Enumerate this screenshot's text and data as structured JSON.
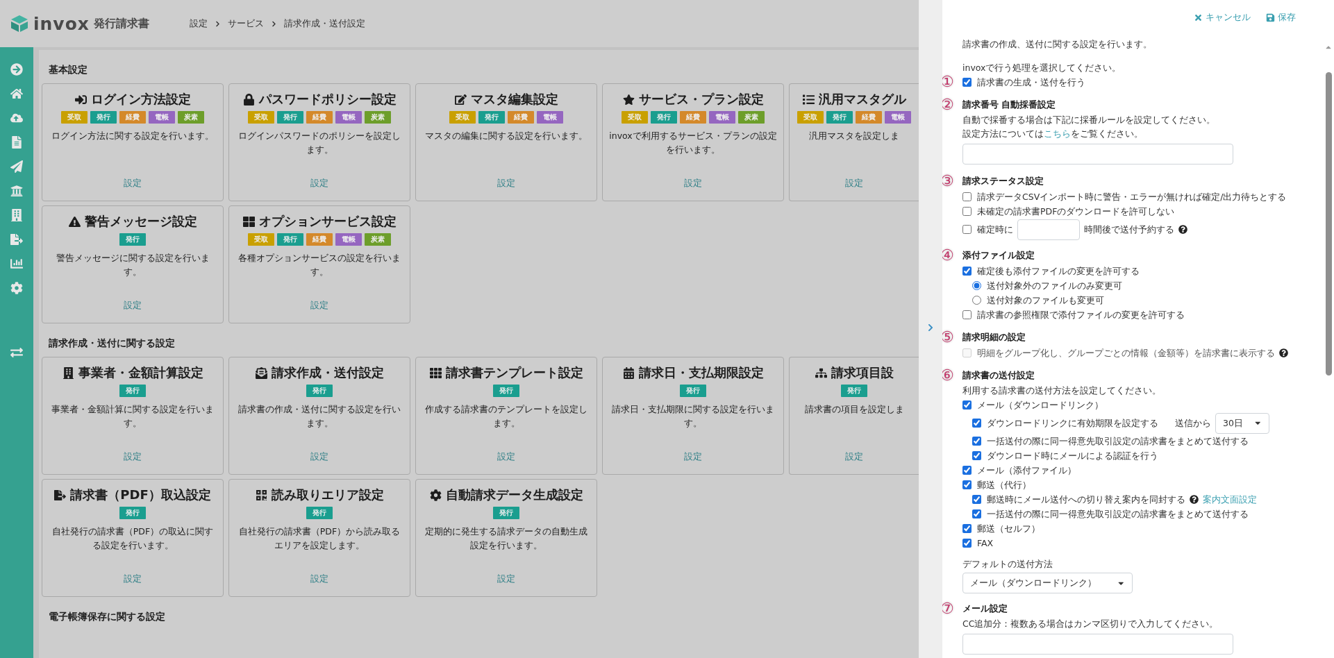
{
  "header": {
    "logo_text": "invox",
    "product": "発行請求書",
    "breadcrumb": [
      "設定",
      "サービス",
      "請求作成・送付設定"
    ]
  },
  "groups": [
    {
      "title": "基本設定",
      "cards": [
        {
          "title": "ログイン方法設定",
          "tags": [
            {
              "label": "受取",
              "color": "#c9a000"
            },
            {
              "label": "発行",
              "color": "#1a9e8f"
            },
            {
              "label": "経費",
              "color": "#d4892a"
            },
            {
              "label": "電帳",
              "color": "#9566c0"
            },
            {
              "label": "炭素",
              "color": "#6d9e2a"
            }
          ],
          "desc": "ログイン方法に関する設定を行います。",
          "link": "設定"
        },
        {
          "title": "パスワードポリシー設定",
          "tags": [
            {
              "label": "受取",
              "color": "#c9a000"
            },
            {
              "label": "発行",
              "color": "#1a9e8f"
            },
            {
              "label": "経費",
              "color": "#d4892a"
            },
            {
              "label": "電帳",
              "color": "#9566c0"
            },
            {
              "label": "炭素",
              "color": "#6d9e2a"
            }
          ],
          "desc": "ログインパスワードのポリシーを設定します。",
          "link": "設定"
        },
        {
          "title": "マスタ編集設定",
          "tags": [
            {
              "label": "受取",
              "color": "#c9a000"
            },
            {
              "label": "発行",
              "color": "#1a9e8f"
            },
            {
              "label": "経費",
              "color": "#d4892a"
            },
            {
              "label": "電帳",
              "color": "#9566c0"
            }
          ],
          "desc": "マスタの編集に関する設定を行います。",
          "link": "設定"
        },
        {
          "title": "サービス・プラン設定",
          "tags": [
            {
              "label": "受取",
              "color": "#c9a000"
            },
            {
              "label": "発行",
              "color": "#1a9e8f"
            },
            {
              "label": "経費",
              "color": "#d4892a"
            },
            {
              "label": "電帳",
              "color": "#9566c0"
            },
            {
              "label": "炭素",
              "color": "#6d9e2a"
            }
          ],
          "desc": "invoxで利用するサービス・プランの設定を行います。",
          "link": "設定"
        },
        {
          "title": "汎用マスタグル",
          "tags": [
            {
              "label": "受取",
              "color": "#c9a000"
            },
            {
              "label": "発行",
              "color": "#1a9e8f"
            },
            {
              "label": "経費",
              "color": "#d4892a"
            },
            {
              "label": "電帳",
              "color": "#9566c0"
            }
          ],
          "desc": "汎用マスタを設定しま",
          "link": "設定"
        },
        {
          "title": "警告メッセージ設定",
          "tags": [
            {
              "label": "発行",
              "color": "#1a9e8f"
            }
          ],
          "desc": "警告メッセージに関する設定を行います。",
          "link": "設定"
        },
        {
          "title": "オプションサービス設定",
          "tags": [
            {
              "label": "受取",
              "color": "#c9a000"
            },
            {
              "label": "発行",
              "color": "#1a9e8f"
            },
            {
              "label": "経費",
              "color": "#d4892a"
            },
            {
              "label": "電帳",
              "color": "#9566c0"
            },
            {
              "label": "炭素",
              "color": "#6d9e2a"
            }
          ],
          "desc": "各種オプションサービスの設定を行います。",
          "link": "設定"
        }
      ]
    },
    {
      "title": "請求作成・送付に関する設定",
      "cards": [
        {
          "title": "事業者・金額計算設定",
          "tags": [
            {
              "label": "発行",
              "color": "#1a9e8f"
            }
          ],
          "desc": "事業者・金額計算に関する設定を行います。",
          "link": "設定"
        },
        {
          "title": "請求作成・送付設定",
          "tags": [
            {
              "label": "発行",
              "color": "#1a9e8f"
            }
          ],
          "desc": "請求書の作成・送付に関する設定を行います。",
          "link": "設定"
        },
        {
          "title": "請求書テンプレート設定",
          "tags": [
            {
              "label": "発行",
              "color": "#1a9e8f"
            }
          ],
          "desc": "作成する請求書のテンプレートを設定します。",
          "link": "設定"
        },
        {
          "title": "請求日・支払期限設定",
          "tags": [
            {
              "label": "発行",
              "color": "#1a9e8f"
            }
          ],
          "desc": "請求日・支払期限に関する設定を行います。",
          "link": "設定"
        },
        {
          "title": "請求項目設",
          "tags": [
            {
              "label": "発行",
              "color": "#1a9e8f"
            }
          ],
          "desc": "請求書の項目を設定しま",
          "link": "設定"
        },
        {
          "title": "請求書（PDF）取込設定",
          "tags": [
            {
              "label": "発行",
              "color": "#1a9e8f"
            }
          ],
          "desc": "自社発行の請求書（PDF）の取込に関する設定を行います。",
          "link": "設定"
        },
        {
          "title": "読み取りエリア設定",
          "tags": [
            {
              "label": "発行",
              "color": "#1a9e8f"
            }
          ],
          "desc": "自社発行の請求書（PDF）から読み取るエリアを設定します。",
          "link": "設定"
        },
        {
          "title": "自動請求データ生成設定",
          "tags": [
            {
              "label": "発行",
              "color": "#1a9e8f"
            }
          ],
          "desc": "定期的に発生する請求データの自動生成設定を行います。",
          "link": "設定"
        }
      ]
    },
    {
      "title": "電子帳簿保存に関する設定"
    }
  ],
  "panel": {
    "actions": [
      {
        "kind": "cancel",
        "label": "キャンセル"
      },
      {
        "kind": "save",
        "label": "保存"
      }
    ],
    "intro": "請求書の作成、送付に関する設定を行います。",
    "sections": [
      {
        "lead": "invoxで行う処理を選択してください。",
        "marker": "①",
        "items": [
          {
            "kind": "checkbox",
            "label": "請求書の生成・送付を行う",
            "checked": true,
            "disabled": false
          }
        ]
      },
      {
        "marker": "②",
        "title": "請求番号 自動採番設定",
        "items": [
          {
            "kind": "text",
            "text": "自動で採番する場合は下記に採番ルールを設定してください。"
          },
          {
            "kind": "link_text",
            "before": "設定方法については",
            "link": "こちら",
            "after": "をご覧ください。"
          },
          {
            "kind": "input"
          }
        ]
      },
      {
        "marker": "③",
        "title": "請求ステータス設定",
        "items": [
          {
            "kind": "checkbox",
            "label": "請求データCSVインポート時に警告・エラーが無ければ確定/出力待ちとする",
            "checked": false,
            "disabled": false
          },
          {
            "kind": "checkbox",
            "label": "未確定の請求書PDFのダウンロードを許可しない",
            "checked": false,
            "disabled": false
          },
          {
            "kind": "hours",
            "before": "確定時に",
            "after": "時間後で送付予約する",
            "checked": false,
            "disabled": false,
            "help": true
          }
        ]
      },
      {
        "marker": "④",
        "title": "添付ファイル設定",
        "items": [
          {
            "kind": "checkbox",
            "label": "確定後も添付ファイルの変更を許可する",
            "checked": true,
            "disabled": false,
            "children": [
              {
                "kind": "radio",
                "label": "送付対象外のファイルのみ変更可",
                "selected": true
              },
              {
                "kind": "radio",
                "label": "送付対象のファイルも変更可",
                "selected": false
              }
            ]
          },
          {
            "kind": "checkbox",
            "label": "請求書の参照権限で添付ファイルの変更を許可する",
            "checked": false,
            "disabled": false
          }
        ]
      },
      {
        "marker": "⑤",
        "title": "請求明細の設定",
        "items": [
          {
            "kind": "checkbox",
            "label": "明細をグループ化し、グループごとの情報（金額等）を請求書に表示する",
            "checked": false,
            "disabled": true,
            "help": true
          }
        ]
      },
      {
        "marker": "⑥",
        "title": "請求書の送付設定",
        "items": [
          {
            "kind": "text",
            "text": "利用する請求書の送付方法を設定してください。"
          },
          {
            "kind": "checkbox",
            "label": "メール（ダウンロードリンク）",
            "checked": true,
            "disabled": false,
            "children": [
              {
                "kind": "checkbox",
                "label": "ダウンロードリンクに有効期限を設定する",
                "checked": true,
                "disabled": false,
                "suffix": "送信から",
                "select": "30日"
              },
              {
                "kind": "checkbox",
                "label": "一括送付の際に同一得意先取引設定の請求書をまとめて送付する",
                "checked": true,
                "disabled": false
              },
              {
                "kind": "checkbox",
                "label": "ダウンロード時にメールによる認証を行う",
                "checked": true,
                "disabled": false
              }
            ]
          },
          {
            "kind": "checkbox",
            "label": "メール（添付ファイル）",
            "checked": true,
            "disabled": false
          },
          {
            "kind": "checkbox",
            "label": "郵送（代行）",
            "checked": true,
            "disabled": false,
            "children": [
              {
                "kind": "checkbox",
                "label": "郵送時にメール送付への切り替え案内を同封する",
                "checked": true,
                "disabled": false,
                "help": true,
                "link": "案内文面設定"
              },
              {
                "kind": "checkbox",
                "label": "一括送付の際に同一得意先取引設定の請求書をまとめて送付する",
                "checked": true,
                "disabled": false
              }
            ]
          },
          {
            "kind": "checkbox",
            "label": "郵送（セルフ）",
            "checked": true,
            "disabled": false
          },
          {
            "kind": "checkbox",
            "label": "FAX",
            "checked": true,
            "disabled": false
          },
          {
            "kind": "select",
            "label": "デフォルトの送付方法",
            "value": "メール（ダウンロードリンク）"
          }
        ]
      },
      {
        "marker": "⑦",
        "title": "メール設定",
        "items": [
          {
            "kind": "text",
            "text": "CC追加分：複数ある場合はカンマ区切りで入力してください。"
          },
          {
            "kind": "input"
          }
        ]
      }
    ]
  }
}
